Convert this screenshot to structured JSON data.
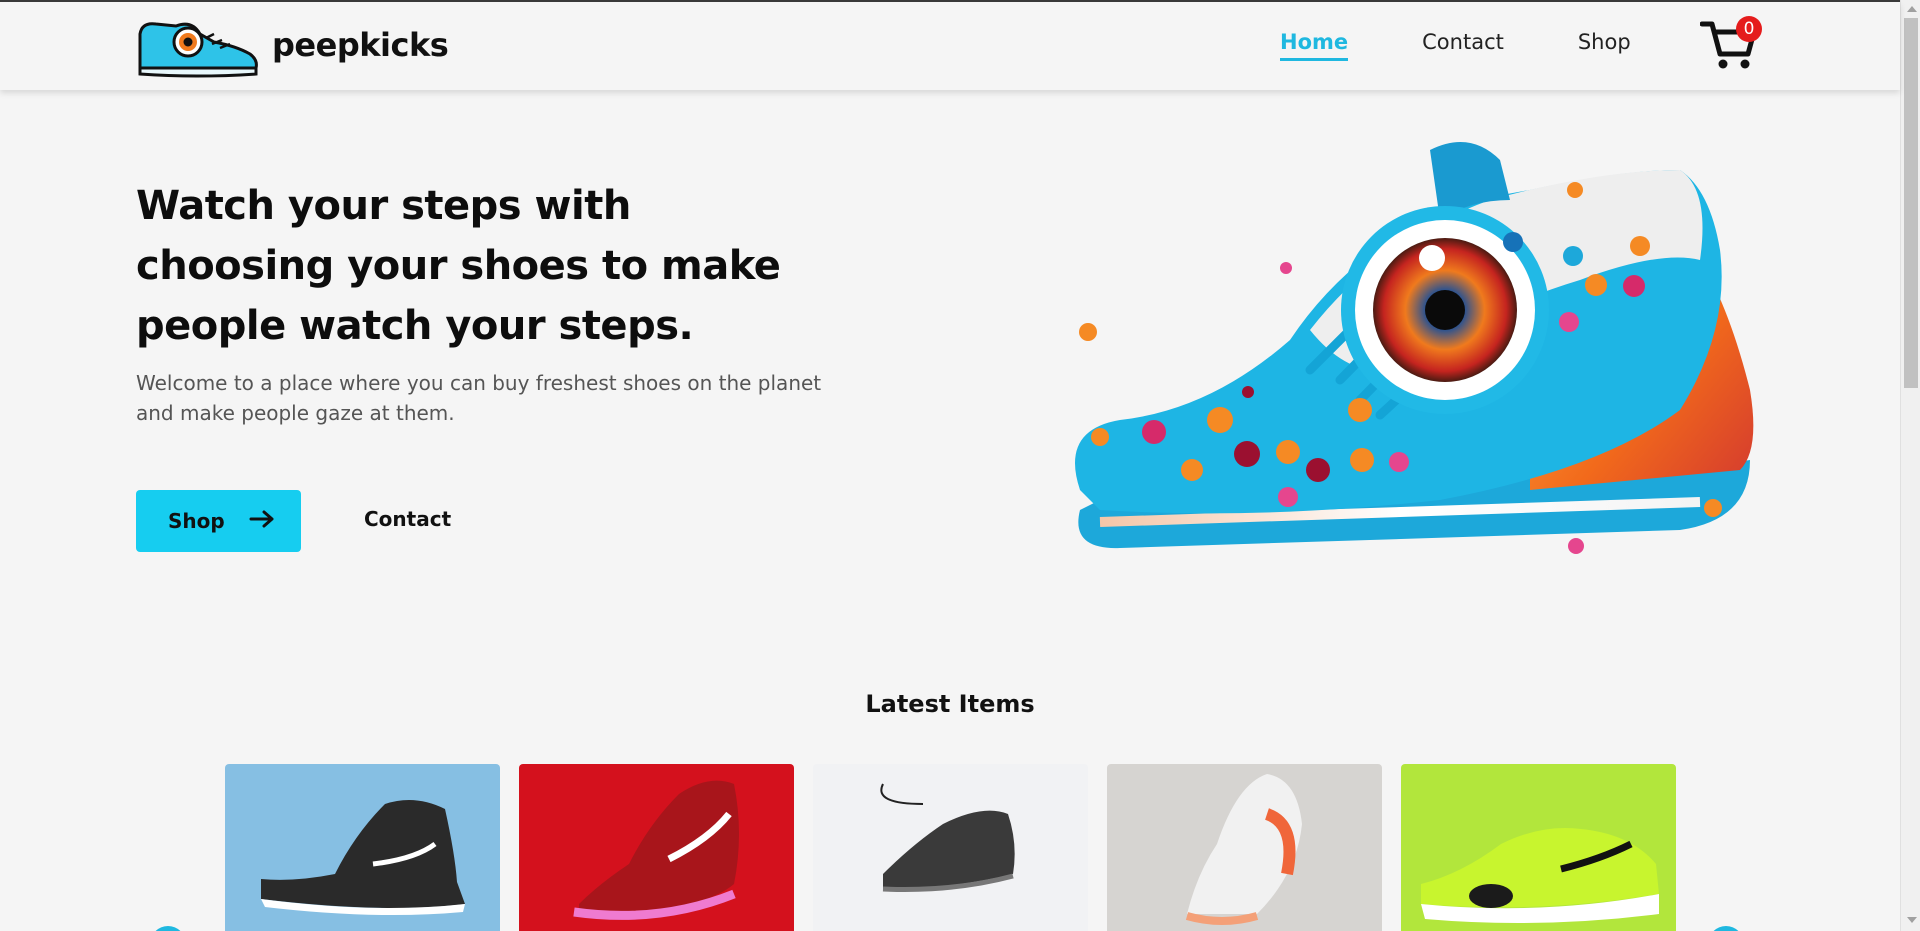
{
  "header": {
    "brand": "peepkicks",
    "nav": [
      {
        "label": "Home",
        "active": true
      },
      {
        "label": "Contact",
        "active": false
      },
      {
        "label": "Shop",
        "active": false
      }
    ],
    "cart_count": "0"
  },
  "hero": {
    "title": "Watch your steps with choosing your shoes to make people watch your steps.",
    "subtitle": "Welcome to a place where you can buy freshest shoes on the planet and make people gaze at them.",
    "shop_button": "Shop",
    "contact_button": "Contact"
  },
  "latest": {
    "title": "Latest Items",
    "cards": [
      {
        "bg": "#86bfe3",
        "shoe": "#2a2a2a"
      },
      {
        "bg": "#d4111d",
        "shoe": "#a8151b"
      },
      {
        "bg": "#f1f2f4",
        "shoe": "#3a3a3a"
      },
      {
        "bg": "#d6d4d1",
        "shoe": "#f1f1f1"
      },
      {
        "bg": "#b2e63c",
        "shoe": "#c8f52e"
      }
    ]
  },
  "colors": {
    "accent": "#16cdf0",
    "badge": "#e51c1c"
  }
}
